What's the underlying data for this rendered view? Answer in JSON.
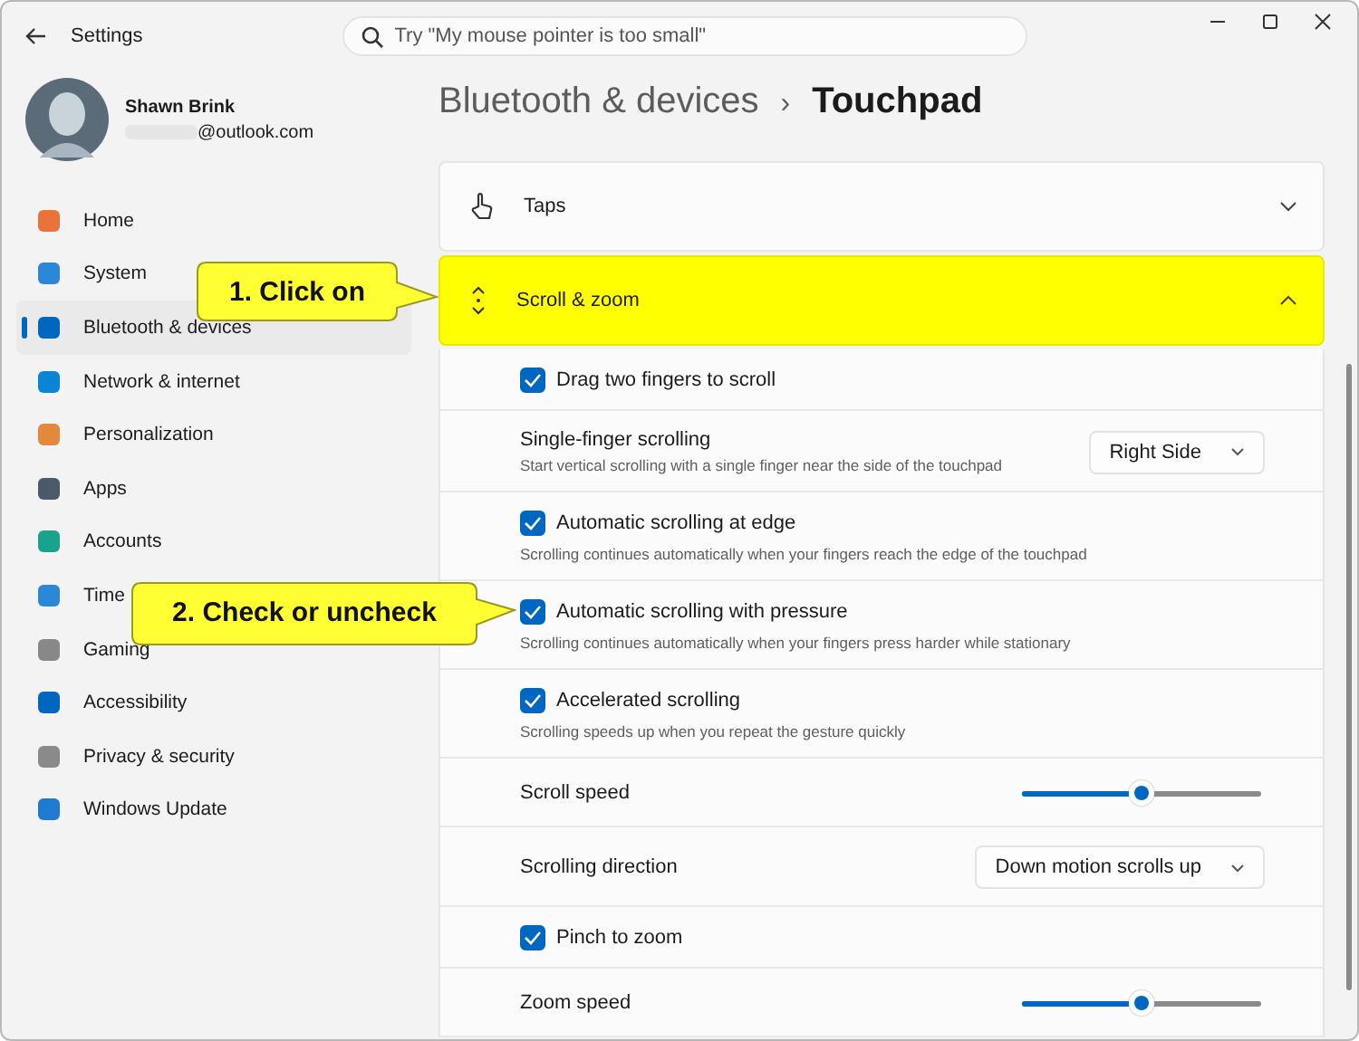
{
  "window": {
    "title": "Settings"
  },
  "search": {
    "placeholder": "Try \"My mouse pointer is too small\""
  },
  "user": {
    "name": "Shawn Brink",
    "email": "@outlook.com"
  },
  "nav": [
    {
      "label": "Home",
      "selected": false
    },
    {
      "label": "System",
      "selected": false
    },
    {
      "label": "Bluetooth & devices",
      "selected": true
    },
    {
      "label": "Network & internet",
      "selected": false
    },
    {
      "label": "Personalization",
      "selected": false
    },
    {
      "label": "Apps",
      "selected": false
    },
    {
      "label": "Accounts",
      "selected": false
    },
    {
      "label": "Time",
      "selected": false
    },
    {
      "label": "Gaming",
      "selected": false
    },
    {
      "label": "Accessibility",
      "selected": false
    },
    {
      "label": "Privacy & security",
      "selected": false
    },
    {
      "label": "Windows Update",
      "selected": false
    }
  ],
  "breadcrumb": {
    "parent": "Bluetooth & devices",
    "separator": "›",
    "current": "Touchpad"
  },
  "sections": [
    {
      "title": "Taps",
      "expanded": false,
      "highlighted": false
    },
    {
      "title": "Scroll & zoom",
      "expanded": true,
      "highlighted": true,
      "settings": [
        {
          "kind": "checkbox",
          "label": "Drag two fingers to scroll",
          "checked": true
        },
        {
          "kind": "dropdown",
          "label": "Single-finger scrolling",
          "description": "Start vertical scrolling with a single finger near the side of the touchpad",
          "value": "Right Side"
        },
        {
          "kind": "checkbox",
          "label": "Automatic scrolling at edge",
          "checked": true,
          "description": "Scrolling continues automatically when your fingers reach the edge of the touchpad"
        },
        {
          "kind": "checkbox",
          "label": "Automatic scrolling with pressure",
          "checked": true,
          "description": "Scrolling continues automatically when your fingers press harder while stationary"
        },
        {
          "kind": "checkbox",
          "label": "Accelerated scrolling",
          "checked": true,
          "description": "Scrolling speeds up when you repeat the gesture quickly"
        },
        {
          "kind": "slider",
          "label": "Scroll speed",
          "level": 0.5
        },
        {
          "kind": "dropdown",
          "label": "Scrolling direction",
          "value": "Down motion scrolls up"
        },
        {
          "kind": "checkbox",
          "label": "Pinch to zoom",
          "checked": true
        },
        {
          "kind": "slider",
          "label": "Zoom speed",
          "level": 0.5
        }
      ]
    }
  ],
  "callouts": [
    {
      "text": "1. Click on"
    },
    {
      "text": "2. Check or uncheck"
    }
  ]
}
